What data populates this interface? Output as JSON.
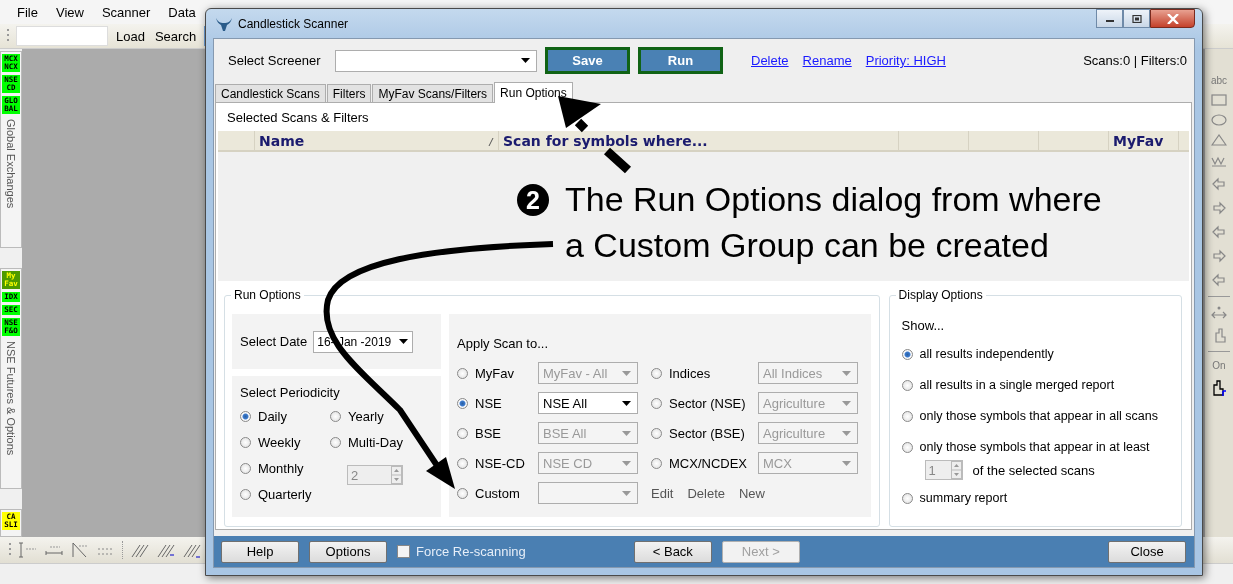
{
  "menu_bar": [
    {
      "label": "File"
    },
    {
      "label": "View"
    },
    {
      "label": "Scanner"
    },
    {
      "label": "Data"
    }
  ],
  "toolbar": {
    "buttons": [
      "Load",
      "Search"
    ]
  },
  "left_sidebar": [
    {
      "badges": [
        {
          "lines": [
            "MCX",
            "NCX"
          ],
          "color": "#00ff00"
        },
        {
          "lines": [
            "NSE",
            "CD"
          ],
          "color": "#00ff00"
        },
        {
          "lines": [
            "GLO",
            "BAL"
          ],
          "color": "#00ff00"
        }
      ],
      "title": "Global Exchanges"
    },
    {
      "badges": [
        {
          "lines": [
            "My",
            "Fav"
          ],
          "color": "#4c9a00"
        },
        {
          "lines": [
            "IDX"
          ],
          "color": "#00ff00"
        },
        {
          "lines": [
            "SEC"
          ],
          "color": "#00ff00"
        },
        {
          "lines": [
            "NSE",
            "F&O"
          ],
          "color": "#00ff00"
        }
      ],
      "title": "NSE Futures & Options"
    },
    {
      "badges": [
        {
          "lines": [
            "CA",
            "SLI"
          ],
          "color": "#ffff00"
        }
      ]
    }
  ],
  "right_toolbar": {
    "top_label": "abc",
    "toggle_label": "On"
  },
  "dialog": {
    "title": "Candlestick Scanner",
    "screener_label": "Select Screener",
    "buttons": [
      "Save",
      "Run"
    ],
    "links": [
      "Delete",
      "Rename",
      "Priority: HIGH"
    ],
    "counts": "Scans:0 | Filters:0",
    "tabs": [
      {
        "label": "Candlestick Scans",
        "selected": false
      },
      {
        "label": "Filters",
        "selected": false
      },
      {
        "label": "MyFav Scans/Filters",
        "selected": false
      },
      {
        "label": "Run Options",
        "selected": true
      }
    ],
    "panel_title": "Selected Scans & Filters",
    "columns": [
      {
        "kind": "blank"
      },
      {
        "kind": "label",
        "label": "Name",
        "sorted": true
      },
      {
        "kind": "label",
        "label": "Scan for symbols where...",
        "sorted": false
      },
      {
        "kind": "blank"
      },
      {
        "kind": "blank"
      },
      {
        "kind": "blank"
      },
      {
        "kind": "label",
        "label": "MyFav",
        "sorted": false
      },
      {
        "kind": "blank"
      }
    ],
    "run_options": {
      "title": "Run Options",
      "date_label": "Select Date",
      "date": "16- Jan -2019",
      "periodicity_label": "Select Periodicity",
      "periodicity": [
        {
          "label": "Daily",
          "selected": true
        },
        {
          "label": "Yearly",
          "selected": false
        },
        {
          "label": "Weekly",
          "selected": false
        },
        {
          "label": "Multi-Day",
          "selected": false
        },
        {
          "label": "Monthly",
          "selected": false
        },
        {
          "label": "Quarterly",
          "selected": false
        }
      ],
      "days": "2",
      "apply_label": "Apply Scan to...",
      "targets": [
        {
          "label": "MyFav",
          "selected": false,
          "value": "MyFav - All",
          "disabled": true
        },
        {
          "label": "Indices",
          "selected": false,
          "value": "All Indices",
          "disabled": true
        },
        {
          "label": "NSE",
          "selected": true,
          "value": "NSE All",
          "disabled": false
        },
        {
          "label": "Sector (NSE)",
          "selected": false,
          "value": "Agriculture",
          "disabled": true
        },
        {
          "label": "BSE",
          "selected": false,
          "value": "BSE All",
          "disabled": true
        },
        {
          "label": "Sector (BSE)",
          "selected": false,
          "value": "Agriculture",
          "disabled": true
        },
        {
          "label": "NSE-CD",
          "selected": false,
          "value": "NSE CD",
          "disabled": true
        },
        {
          "label": "MCX/NCDEX",
          "selected": false,
          "value": "MCX",
          "disabled": true
        },
        {
          "label": "Custom",
          "selected": false,
          "disabled": true,
          "actions": [
            "Edit",
            "Delete",
            "New"
          ]
        }
      ]
    },
    "display_options": {
      "title": "Display Options",
      "show_label": "Show...",
      "options": [
        {
          "label": "all results independently",
          "selected": true
        },
        {
          "label": "all results in a single merged report",
          "selected": false
        },
        {
          "label": "only those symbols that appear in all scans",
          "selected": false
        },
        {
          "label": "only those symbols that appear in at least",
          "selected": false,
          "count": "1",
          "count_suffix": "of the selected scans"
        },
        {
          "label": "summary report",
          "selected": false
        }
      ]
    },
    "footer": {
      "left_buttons": [
        {
          "label": "Help",
          "disabled": false
        },
        {
          "label": "Options",
          "disabled": false
        }
      ],
      "checkbox": {
        "label": "Force Re-scanning",
        "checked": false
      },
      "nav_buttons": [
        {
          "label": "< Back",
          "disabled": false
        },
        {
          "label": "Next >",
          "disabled": true
        }
      ],
      "close": "Close"
    }
  },
  "annotation": {
    "marker": "2",
    "text": "The Run Options dialog from where\na Custom Group can be created"
  }
}
